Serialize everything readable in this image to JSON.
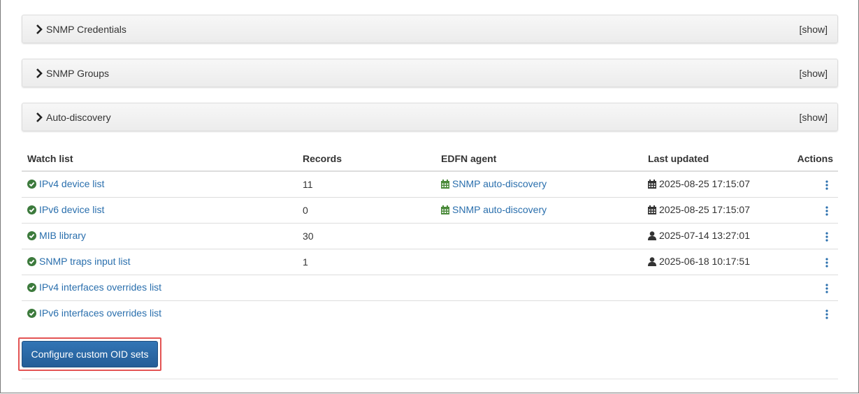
{
  "panels": [
    {
      "title": "SNMP Credentials",
      "toggle": "[show]"
    },
    {
      "title": "SNMP Groups",
      "toggle": "[show]"
    },
    {
      "title": "Auto-discovery",
      "toggle": "[show]"
    }
  ],
  "table": {
    "headers": {
      "watch_list": "Watch list",
      "records": "Records",
      "agent": "EDFN agent",
      "updated": "Last updated",
      "actions": "Actions"
    },
    "rows": [
      {
        "name": "IPv4 device list",
        "records": "11",
        "agent": "SNMP auto-discovery",
        "updated": "2025-08-25 17:15:07",
        "updated_icon": "calendar-icon"
      },
      {
        "name": "IPv6 device list",
        "records": "0",
        "agent": "SNMP auto-discovery",
        "updated": "2025-08-25 17:15:07",
        "updated_icon": "calendar-icon"
      },
      {
        "name": "MIB library",
        "records": "30",
        "agent": "",
        "updated": "2025-07-14 13:27:01",
        "updated_icon": "user-icon"
      },
      {
        "name": "SNMP traps input list",
        "records": "1",
        "agent": "",
        "updated": "2025-06-18 10:17:51",
        "updated_icon": "user-icon"
      },
      {
        "name": "IPv4 interfaces overrides list",
        "records": "",
        "agent": "",
        "updated": "",
        "updated_icon": ""
      },
      {
        "name": "IPv6 interfaces overrides list",
        "records": "",
        "agent": "",
        "updated": "",
        "updated_icon": ""
      }
    ]
  },
  "configure_button": "Configure custom OID sets",
  "colors": {
    "link": "#2a6fad",
    "status_ok": "#3c7a3c",
    "agent_icon": "#4a8a3a",
    "button": "#2b6aa8",
    "highlight": "#e35454"
  }
}
